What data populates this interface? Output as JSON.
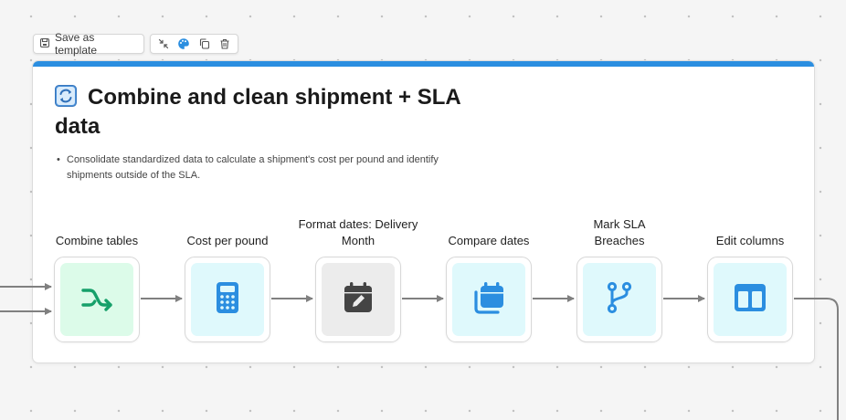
{
  "toolbar": {
    "save_template_label": "Save as template",
    "tools": [
      {
        "icon": "collapse-icon"
      },
      {
        "icon": "palette-icon"
      },
      {
        "icon": "duplicate-icon"
      },
      {
        "icon": "trash-icon"
      }
    ]
  },
  "card": {
    "title": "Combine and clean shipment + SLA data",
    "title_icon": "refresh-icon",
    "description": "Consolidate standardized data to calculate a shipment's cost per pound and identify shipments outside of the SLA.",
    "accent_color": "#2b8ee0"
  },
  "steps": [
    {
      "label": "Combine tables",
      "icon": "merge-icon",
      "tile_color": "#dcfbe9",
      "icon_color": "#16a06a"
    },
    {
      "label": "Cost per pound",
      "icon": "calculator-icon",
      "tile_color": "#dff9fc",
      "icon_color": "#2b8ee0"
    },
    {
      "label": "Format dates: Delivery Month",
      "icon": "calendar-edit-icon",
      "tile_color": "#ececec",
      "icon_color": "#444444"
    },
    {
      "label": "Compare dates",
      "icon": "calendar-stack-icon",
      "tile_color": "#dff9fc",
      "icon_color": "#2b8ee0"
    },
    {
      "label": "Mark SLA Breaches",
      "icon": "branch-icon",
      "tile_color": "#dff9fc",
      "icon_color": "#2b8ee0"
    },
    {
      "label": "Edit columns",
      "icon": "columns-icon",
      "tile_color": "#dff9fc",
      "icon_color": "#2b8ee0"
    }
  ]
}
